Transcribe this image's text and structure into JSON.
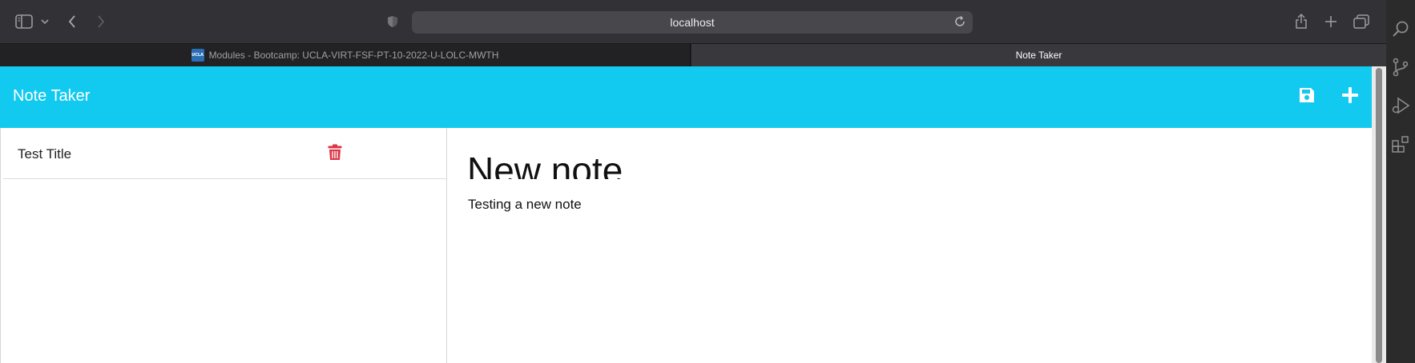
{
  "browser": {
    "url": "localhost",
    "tabs": [
      {
        "label": "Modules - Bootcamp: UCLA-VIRT-FSF-PT-10-2022-U-LOLC-MWTH",
        "favicon_text": "UCLA",
        "active": false
      },
      {
        "label": "Note Taker",
        "active": true
      }
    ]
  },
  "app": {
    "brand": "Note Taker",
    "accent_color": "#12c9ef",
    "delete_color": "#dc3545",
    "notes": [
      {
        "title": "Test Title"
      }
    ],
    "editor": {
      "title": "New note",
      "text": "Testing a new note"
    },
    "icons": {
      "save": "save-icon",
      "new": "plus-icon",
      "delete": "trash-icon"
    }
  }
}
